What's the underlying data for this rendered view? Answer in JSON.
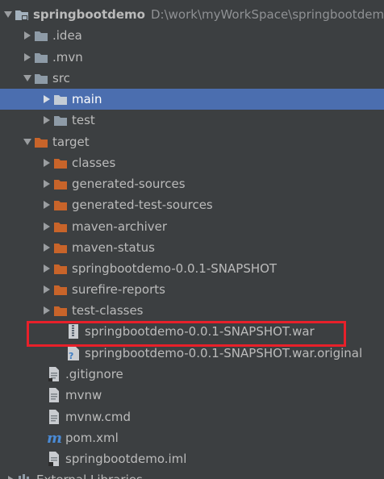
{
  "project": {
    "name": "springbootdemo",
    "path": "D:\\work\\myWorkSpace\\springbootdem"
  },
  "folders": {
    "idea": ".idea",
    "mvn": ".mvn",
    "src": "src",
    "main": "main",
    "test": "test",
    "target": "target",
    "classes": "classes",
    "generated_sources": "generated-sources",
    "generated_test_sources": "generated-test-sources",
    "maven_archiver": "maven-archiver",
    "maven_status": "maven-status",
    "snapshot_dir": "springbootdemo-0.0.1-SNAPSHOT",
    "surefire_reports": "surefire-reports",
    "test_classes": "test-classes"
  },
  "files": {
    "war": "springbootdemo-0.0.1-SNAPSHOT.war",
    "war_original": "springbootdemo-0.0.1-SNAPSHOT.war.original",
    "gitignore": ".gitignore",
    "mvnw": "mvnw",
    "mvnw_cmd": "mvnw.cmd",
    "pom": "pom.xml",
    "iml": "springbootdemo.iml"
  },
  "external_libraries": "External Libraries",
  "colors": {
    "background": "#3c3f41",
    "selection": "#4b6eaf",
    "folder_gray": "#a9b7c6",
    "folder_orange": "#c8642a",
    "highlight": "#e8202a"
  }
}
